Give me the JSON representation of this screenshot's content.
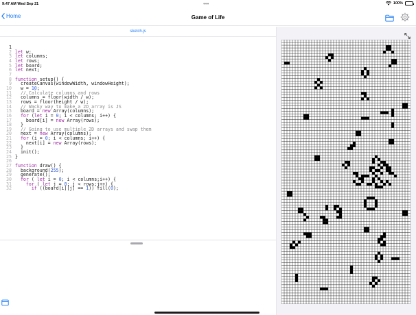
{
  "status_bar": {
    "time": "9:47 AM  Wed Sep 21",
    "multitask_dots": "•••",
    "battery_percent": "100%",
    "battery_level": 1.0
  },
  "nav": {
    "back_label": "Home",
    "title": "Game of Life"
  },
  "editor": {
    "file_name": "sketch.js",
    "lines": [
      [
        {
          "t": ""
        }
      ],
      [
        {
          "k": "kw",
          "t": "let"
        },
        {
          "t": " w;"
        }
      ],
      [
        {
          "k": "kw",
          "t": "let"
        },
        {
          "t": " columns;"
        }
      ],
      [
        {
          "k": "kw",
          "t": "let"
        },
        {
          "t": " rows;"
        }
      ],
      [
        {
          "k": "kw",
          "t": "let"
        },
        {
          "t": " board;"
        }
      ],
      [
        {
          "k": "kw",
          "t": "let"
        },
        {
          "t": " next;"
        }
      ],
      [
        {
          "t": ""
        }
      ],
      [
        {
          "k": "kw",
          "t": "function"
        },
        {
          "t": " setup() {"
        }
      ],
      [
        {
          "t": "  createCanvas(windowWidth, windowHeight);"
        }
      ],
      [
        {
          "t": "  w = "
        },
        {
          "k": "num",
          "t": "10"
        },
        {
          "t": ";"
        }
      ],
      [
        {
          "k": "comment",
          "t": "  // Calculate columns and rows"
        }
      ],
      [
        {
          "t": "  columns = floor(width / w);"
        }
      ],
      [
        {
          "t": "  rows = floor(height / w);"
        }
      ],
      [
        {
          "k": "comment",
          "t": "  // Wacky way to make a 2D array is JS"
        }
      ],
      [
        {
          "t": "  board = "
        },
        {
          "k": "kw",
          "t": "new"
        },
        {
          "t": " Array(columns);"
        }
      ],
      [
        {
          "t": "  "
        },
        {
          "k": "kw",
          "t": "for"
        },
        {
          "t": " ("
        },
        {
          "k": "kw",
          "t": "let"
        },
        {
          "t": " i = "
        },
        {
          "k": "num",
          "t": "0"
        },
        {
          "t": "; i < columns; i++) {"
        }
      ],
      [
        {
          "t": "    board[i] = "
        },
        {
          "k": "kw",
          "t": "new"
        },
        {
          "t": " Array(rows);"
        }
      ],
      [
        {
          "t": "  }"
        }
      ],
      [
        {
          "k": "comment",
          "t": "  // Going to use multiple 2D arrays and swap them"
        }
      ],
      [
        {
          "t": "  next = "
        },
        {
          "k": "kw",
          "t": "new"
        },
        {
          "t": " Array(columns);"
        }
      ],
      [
        {
          "t": "  "
        },
        {
          "k": "kw",
          "t": "for"
        },
        {
          "t": " (i = "
        },
        {
          "k": "num",
          "t": "0"
        },
        {
          "t": "; i < columns; i++) {"
        }
      ],
      [
        {
          "t": "    next[i] = "
        },
        {
          "k": "kw",
          "t": "new"
        },
        {
          "t": " Array(rows);"
        }
      ],
      [
        {
          "t": "  }"
        }
      ],
      [
        {
          "t": "  init();"
        }
      ],
      [
        {
          "t": "}"
        }
      ],
      [
        {
          "t": ""
        }
      ],
      [
        {
          "k": "kw",
          "t": "function"
        },
        {
          "t": " draw() {"
        }
      ],
      [
        {
          "t": "  background("
        },
        {
          "k": "num",
          "t": "255"
        },
        {
          "t": ");"
        }
      ],
      [
        {
          "t": "  generate();"
        }
      ],
      [
        {
          "t": "  "
        },
        {
          "k": "kw",
          "t": "for"
        },
        {
          "t": " ( "
        },
        {
          "k": "kw",
          "t": "let"
        },
        {
          "t": " i = "
        },
        {
          "k": "num",
          "t": "0"
        },
        {
          "t": "; i < columns;i++) {"
        }
      ],
      [
        {
          "t": "    "
        },
        {
          "k": "kw",
          "t": "for"
        },
        {
          "t": " ( "
        },
        {
          "k": "kw",
          "t": "let"
        },
        {
          "t": " j = "
        },
        {
          "k": "num",
          "t": "0"
        },
        {
          "t": "; j < rows;j++) {"
        }
      ],
      [
        {
          "t": "      "
        },
        {
          "k": "kw",
          "t": "if"
        },
        {
          "t": " ((board[i][j] == "
        },
        {
          "k": "num",
          "t": "1"
        },
        {
          "t": ")) fill("
        },
        {
          "k": "num",
          "t": "0"
        },
        {
          "t": ");"
        }
      ]
    ]
  },
  "canvas": {
    "columns": 47,
    "rows": 96,
    "alive_cells": [
      [
        38,
        2
      ],
      [
        39,
        2
      ],
      [
        38,
        3
      ],
      [
        39,
        3
      ],
      [
        37,
        4
      ],
      [
        40,
        4
      ],
      [
        17,
        5
      ],
      [
        18,
        5
      ],
      [
        16,
        6
      ],
      [
        18,
        6
      ],
      [
        17,
        7
      ],
      [
        40,
        7
      ],
      [
        41,
        7
      ],
      [
        1,
        8
      ],
      [
        2,
        8
      ],
      [
        40,
        8
      ],
      [
        41,
        8
      ],
      [
        39,
        9
      ],
      [
        30,
        10
      ],
      [
        29,
        11
      ],
      [
        31,
        11
      ],
      [
        29,
        12
      ],
      [
        31,
        12
      ],
      [
        30,
        13
      ],
      [
        13,
        14
      ],
      [
        12,
        15
      ],
      [
        14,
        15
      ],
      [
        13,
        16
      ],
      [
        12,
        17
      ],
      [
        14,
        17
      ],
      [
        29,
        19
      ],
      [
        30,
        19
      ],
      [
        30,
        20
      ],
      [
        29,
        21
      ],
      [
        31,
        21
      ],
      [
        44,
        23
      ],
      [
        45,
        23
      ],
      [
        44,
        24
      ],
      [
        45,
        24
      ],
      [
        36,
        26
      ],
      [
        37,
        26
      ],
      [
        38,
        26
      ],
      [
        40,
        25
      ],
      [
        40,
        26
      ],
      [
        40,
        27
      ],
      [
        8,
        27
      ],
      [
        9,
        27
      ],
      [
        8,
        28
      ],
      [
        9,
        28
      ],
      [
        29,
        28
      ],
      [
        30,
        28
      ],
      [
        31,
        28
      ],
      [
        40,
        30
      ],
      [
        40,
        31
      ],
      [
        27,
        33
      ],
      [
        28,
        33
      ],
      [
        27,
        34
      ],
      [
        28,
        34
      ],
      [
        39,
        36
      ],
      [
        40,
        36
      ],
      [
        39,
        37
      ],
      [
        40,
        37
      ],
      [
        26,
        37
      ],
      [
        25,
        38
      ],
      [
        26,
        38
      ],
      [
        24,
        39
      ],
      [
        25,
        39
      ],
      [
        12,
        42
      ],
      [
        13,
        42
      ],
      [
        12,
        43
      ],
      [
        13,
        43
      ],
      [
        34,
        42
      ],
      [
        33,
        43
      ],
      [
        35,
        43
      ],
      [
        23,
        44
      ],
      [
        24,
        44
      ],
      [
        33,
        44
      ],
      [
        36,
        44
      ],
      [
        37,
        44
      ],
      [
        22,
        45
      ],
      [
        24,
        45
      ],
      [
        35,
        45
      ],
      [
        37,
        45
      ],
      [
        38,
        45
      ],
      [
        23,
        46
      ],
      [
        32,
        46
      ],
      [
        33,
        46
      ],
      [
        36,
        46
      ],
      [
        38,
        46
      ],
      [
        39,
        46
      ],
      [
        32,
        47
      ],
      [
        34,
        47
      ],
      [
        35,
        47
      ],
      [
        38,
        47
      ],
      [
        39,
        47
      ],
      [
        26,
        48
      ],
      [
        27,
        48
      ],
      [
        33,
        48
      ],
      [
        36,
        48
      ],
      [
        39,
        48
      ],
      [
        40,
        48
      ],
      [
        27,
        49
      ],
      [
        29,
        49
      ],
      [
        30,
        49
      ],
      [
        31,
        49
      ],
      [
        34,
        49
      ],
      [
        41,
        49
      ],
      [
        28,
        50
      ],
      [
        29,
        50
      ],
      [
        33,
        50
      ],
      [
        35,
        50
      ],
      [
        26,
        51
      ],
      [
        29,
        51
      ],
      [
        33,
        51
      ],
      [
        36,
        51
      ],
      [
        38,
        51
      ],
      [
        27,
        52
      ],
      [
        28,
        52
      ],
      [
        31,
        52
      ],
      [
        32,
        52
      ],
      [
        34,
        52
      ],
      [
        37,
        52
      ],
      [
        39,
        52
      ],
      [
        34,
        53
      ],
      [
        35,
        53
      ],
      [
        36,
        53
      ],
      [
        2,
        55
      ],
      [
        3,
        55
      ],
      [
        2,
        56
      ],
      [
        3,
        56
      ],
      [
        31,
        57
      ],
      [
        32,
        57
      ],
      [
        33,
        57
      ],
      [
        30,
        58
      ],
      [
        34,
        58
      ],
      [
        30,
        59
      ],
      [
        34,
        59
      ],
      [
        30,
        60
      ],
      [
        34,
        60
      ],
      [
        31,
        61
      ],
      [
        32,
        61
      ],
      [
        33,
        61
      ],
      [
        6,
        61
      ],
      [
        7,
        61
      ],
      [
        6,
        62
      ],
      [
        7,
        62
      ],
      [
        16,
        60
      ],
      [
        16,
        61
      ],
      [
        19,
        60
      ],
      [
        20,
        60
      ],
      [
        19,
        61
      ],
      [
        21,
        61
      ],
      [
        20,
        62
      ],
      [
        21,
        62
      ],
      [
        21,
        63
      ],
      [
        20,
        64
      ],
      [
        21,
        64
      ],
      [
        8,
        63
      ],
      [
        9,
        64
      ],
      [
        8,
        65
      ],
      [
        44,
        62
      ],
      [
        45,
        62
      ],
      [
        44,
        63
      ],
      [
        45,
        63
      ],
      [
        14,
        64
      ],
      [
        15,
        64
      ],
      [
        15,
        65
      ],
      [
        16,
        65
      ],
      [
        15,
        66
      ],
      [
        16,
        66
      ],
      [
        30,
        68
      ],
      [
        31,
        68
      ],
      [
        30,
        69
      ],
      [
        31,
        69
      ],
      [
        8,
        70
      ],
      [
        9,
        70
      ],
      [
        10,
        70
      ],
      [
        9,
        71
      ],
      [
        10,
        71
      ],
      [
        37,
        70
      ],
      [
        36,
        71
      ],
      [
        37,
        71
      ],
      [
        4,
        73
      ],
      [
        6,
        73
      ],
      [
        3,
        74
      ],
      [
        5,
        74
      ],
      [
        3,
        75
      ],
      [
        4,
        75
      ],
      [
        35,
        72
      ],
      [
        36,
        72
      ],
      [
        35,
        73
      ],
      [
        37,
        73
      ],
      [
        36,
        74
      ],
      [
        37,
        74
      ],
      [
        35,
        77
      ],
      [
        34,
        78
      ],
      [
        36,
        78
      ],
      [
        34,
        79
      ],
      [
        36,
        79
      ],
      [
        35,
        80
      ],
      [
        40,
        79
      ],
      [
        41,
        79
      ],
      [
        42,
        79
      ],
      [
        25,
        82
      ],
      [
        25,
        83
      ],
      [
        25,
        84
      ],
      [
        5,
        85
      ],
      [
        5,
        86
      ],
      [
        5,
        87
      ],
      [
        33,
        86
      ],
      [
        34,
        86
      ],
      [
        33,
        87
      ],
      [
        35,
        87
      ],
      [
        32,
        88
      ],
      [
        34,
        88
      ],
      [
        33,
        89
      ],
      [
        14,
        90
      ],
      [
        15,
        90
      ],
      [
        16,
        90
      ]
    ]
  }
}
